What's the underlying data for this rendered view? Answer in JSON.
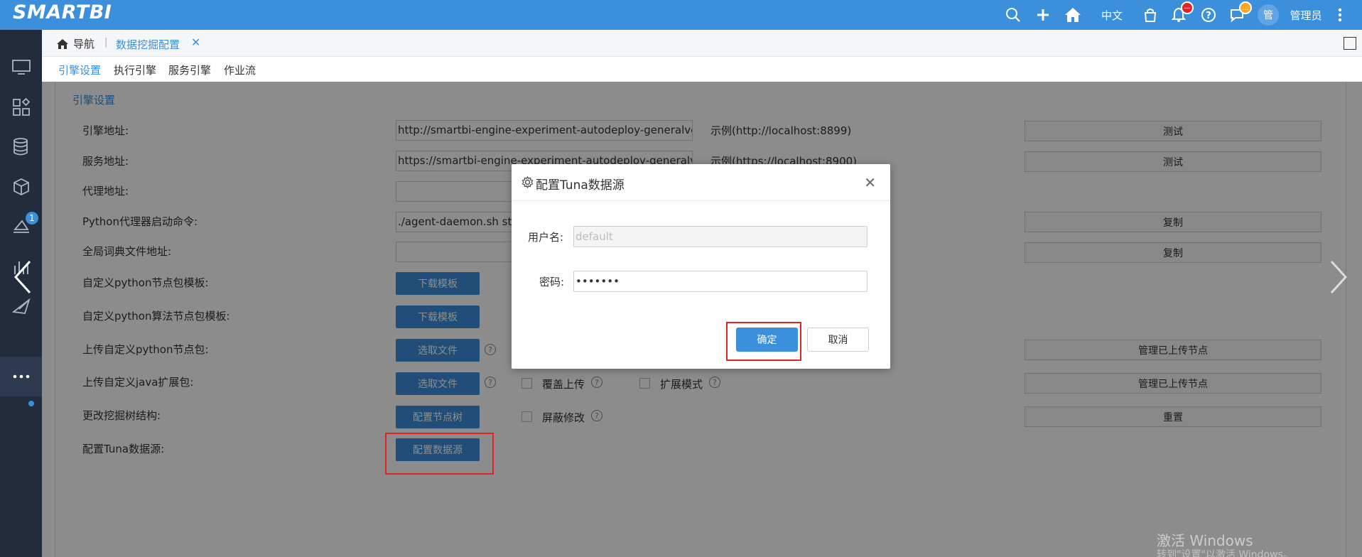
{
  "topbar": {
    "logo": "SMARTBI",
    "lang": "中文",
    "user_avatar": "管",
    "user_name": "管理员",
    "bg": "#3b8fdb",
    "icons": [
      "search-icon",
      "plus-icon",
      "home-icon",
      "bag-icon",
      "bell-icon",
      "help-icon",
      "chat-icon",
      "more-vertical-icon"
    ]
  },
  "sidebar": {
    "badge": "1",
    "icons": [
      "monitor-icon",
      "apps-icon",
      "database-icon",
      "cube-icon",
      "layers-icon",
      "chart-icon",
      "send-icon",
      "more-icon"
    ]
  },
  "breadcrumb": {
    "home": "导航",
    "sep": "|",
    "current": "数据挖掘配置",
    "close": "✕"
  },
  "tabs": [
    "引擎设置",
    "执行引擎",
    "服务引擎",
    "作业流"
  ],
  "section": {
    "title": "引擎设置",
    "rows": [
      {
        "label": "引擎地址:",
        "value": "http://smartbi-engine-experiment-autodeploy-generalver",
        "example": "示例(http://localhost:8899)",
        "button": "测试"
      },
      {
        "label": "服务地址:",
        "value": "https://smartbi-engine-experiment-autodeploy-generalve",
        "example": "示例(https://localhost:8900)",
        "button": "测试"
      },
      {
        "label": "代理地址:",
        "value": ""
      },
      {
        "label": "Python代理器启动命令:",
        "value": "./agent-daemon.sh sta",
        "button": "复制"
      },
      {
        "label": "全局词典文件地址:",
        "value": "",
        "button": "复制"
      },
      {
        "label": "自定义python节点包模板:",
        "action": "下载模板"
      },
      {
        "label": "自定义python算法节点包模板:",
        "action": "下载模板"
      },
      {
        "label": "上传自定义python节点包:",
        "action": "选取文件",
        "button": "管理已上传节点"
      },
      {
        "label": "上传自定义java扩展包:",
        "action": "选取文件",
        "check1": "覆盖上传",
        "check2": "扩展模式",
        "button": "管理已上传节点"
      },
      {
        "label": "更改挖掘树结构:",
        "action": "配置节点树",
        "check1": "屏蔽修改",
        "button": "重置"
      },
      {
        "label": "配置Tuna数据源:",
        "action": "配置数据源"
      }
    ]
  },
  "dialog": {
    "title": "配置Tuna数据源",
    "username_label": "用户名:",
    "username_value": "default",
    "password_label": "密码:",
    "password_value": "•••••••",
    "ok": "确定",
    "cancel": "取消"
  },
  "watermark": {
    "line1": "激活 Windows",
    "line2": "转到\"设置\"以激活 Windows。"
  }
}
